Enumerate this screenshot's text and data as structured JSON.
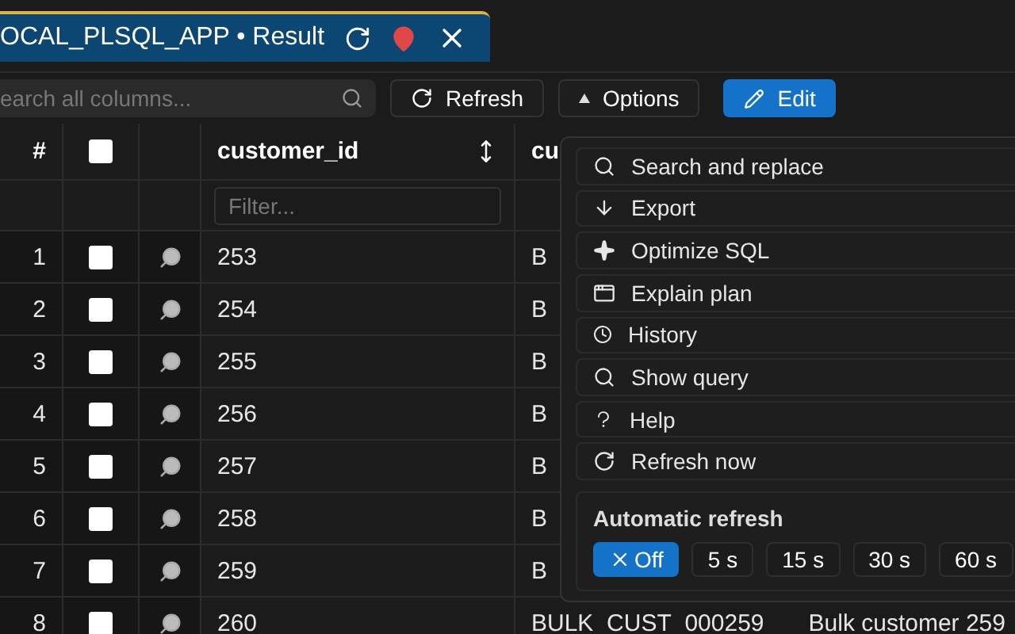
{
  "tab": {
    "title": "OCAL_PLSQL_APP • Result",
    "selected": true
  },
  "toolbar": {
    "search": {
      "placeholder": "earch all columns..."
    },
    "buttons": [
      {
        "label": "Refresh",
        "kind": "refresh",
        "primary": false
      },
      {
        "label": "Options",
        "kind": "options",
        "primary": false
      },
      {
        "label": "Edit",
        "kind": "edit",
        "primary": true
      }
    ]
  },
  "table": {
    "columns": [
      {
        "label": "#",
        "kind": "index"
      },
      {
        "kind": "check",
        "checked": false
      },
      {
        "kind": "inspect"
      },
      {
        "label": "customer_id",
        "kind": "data",
        "filter_placeholder": "Filter..."
      },
      {
        "label": "cu",
        "kind": "data"
      }
    ],
    "rows": [
      {
        "index": "1",
        "checked": false,
        "cells": [
          "253",
          "B"
        ]
      },
      {
        "index": "2",
        "checked": false,
        "cells": [
          "254",
          "B"
        ]
      },
      {
        "index": "3",
        "checked": false,
        "cells": [
          "255",
          "B"
        ]
      },
      {
        "index": "4",
        "checked": false,
        "cells": [
          "256",
          "B"
        ]
      },
      {
        "index": "5",
        "checked": false,
        "cells": [
          "257",
          "B"
        ]
      },
      {
        "index": "6",
        "checked": false,
        "cells": [
          "258",
          "B"
        ]
      },
      {
        "index": "7",
        "checked": false,
        "cells": [
          "259",
          "B"
        ]
      },
      {
        "index": "8",
        "checked": false,
        "cells": [
          "260",
          "BULK_CUST_000259",
          "Bulk customer 259"
        ]
      }
    ]
  },
  "menu": {
    "items": [
      {
        "label": "Search and replace",
        "kind": "search"
      },
      {
        "label": "Export",
        "kind": "export"
      },
      {
        "label": "Optimize SQL",
        "kind": "optimize"
      },
      {
        "label": "Explain plan",
        "kind": "explain"
      },
      {
        "label": "History",
        "kind": "history"
      },
      {
        "label": "Show query",
        "kind": "query"
      },
      {
        "label": "Help",
        "kind": "help"
      },
      {
        "label": "Refresh now",
        "kind": "refresh"
      }
    ],
    "auto_refresh": {
      "title": "Automatic refresh",
      "options": [
        {
          "label": "Off",
          "selected": true
        },
        {
          "label": "5 s",
          "selected": false
        },
        {
          "label": "15 s",
          "selected": false
        },
        {
          "label": "30 s",
          "selected": false
        },
        {
          "label": "60 s",
          "selected": false
        }
      ]
    }
  }
}
